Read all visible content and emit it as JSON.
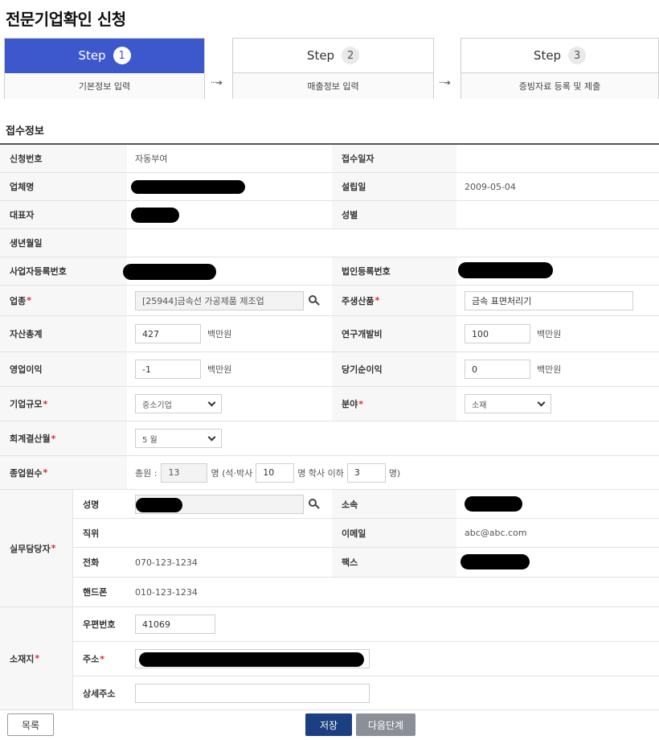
{
  "page": {
    "title": "전문기업확인 신청"
  },
  "steps": [
    {
      "label": "Step",
      "num": "1",
      "desc": "기본정보 입력"
    },
    {
      "label": "Step",
      "num": "2",
      "desc": "매출정보 입력"
    },
    {
      "label": "Step",
      "num": "3",
      "desc": "증빙자료 등록 및 제출"
    }
  ],
  "step_arrow": "···➔",
  "section": {
    "title": "접수정보"
  },
  "form": {
    "application_no_label": "신청번호",
    "application_no_value": "자동부여",
    "received_date_label": "접수일자",
    "company_name_label": "업체명",
    "founded_label": "설립일",
    "founded_value": "2009-05-04",
    "ceo_label": "대표자",
    "gender_label": "성별",
    "birth_label": "생년월일",
    "business_reg_label": "사업자등록번호",
    "corp_reg_label": "법인등록번호",
    "industry_label": "업종",
    "industry_value": "[25944]금속선 가공제품 제조업",
    "main_product_label": "주생산품",
    "main_product_value": "금속 표면처리기",
    "total_assets_label": "자산총계",
    "total_assets_value": "427",
    "rnd_label": "연구개발비",
    "rnd_value": "100",
    "operating_profit_label": "영업이익",
    "operating_profit_value": "-1",
    "net_income_label": "당기순이익",
    "net_income_value": "0",
    "unit_million": "백만원",
    "company_size_label": "기업규모",
    "company_size_value": "중소기업",
    "field_label": "분야",
    "field_value": "소재",
    "fiscal_month_label": "회계결산월",
    "fiscal_month_value": "5 월",
    "employees_label": "종업원수",
    "employees_total_prefix": "총원 :",
    "employees_total_value": "13",
    "employees_masters_prefix": "명 (석·박사",
    "employees_masters_value": "10",
    "employees_bachelor_prefix": "명 학사 이하",
    "employees_bachelor_value": "3",
    "employees_suffix": "명)",
    "contact_group_label": "실무담당자",
    "contact_name_label": "성명",
    "contact_dept_label": "소속",
    "contact_position_label": "직위",
    "contact_email_label": "이메일",
    "contact_email_value": "abc@abc.com",
    "contact_phone_label": "전화",
    "contact_phone_value": "070-123-1234",
    "contact_fax_label": "팩스",
    "contact_mobile_label": "핸드폰",
    "contact_mobile_value": "010-123-1234",
    "location_group_label": "소재지",
    "zip_label": "우편번호",
    "zip_value": "41069",
    "address_label": "주소",
    "address_detail_label": "상세주소",
    "address_detail_value": ""
  },
  "required_mark": "*",
  "buttons": {
    "list": "목록",
    "save": "저장",
    "next": "다음단계"
  },
  "colors": {
    "active_step": "#3d58cc",
    "save_button": "#1c3e82",
    "next_button": "#8b8f97",
    "required": "#d9282f"
  }
}
